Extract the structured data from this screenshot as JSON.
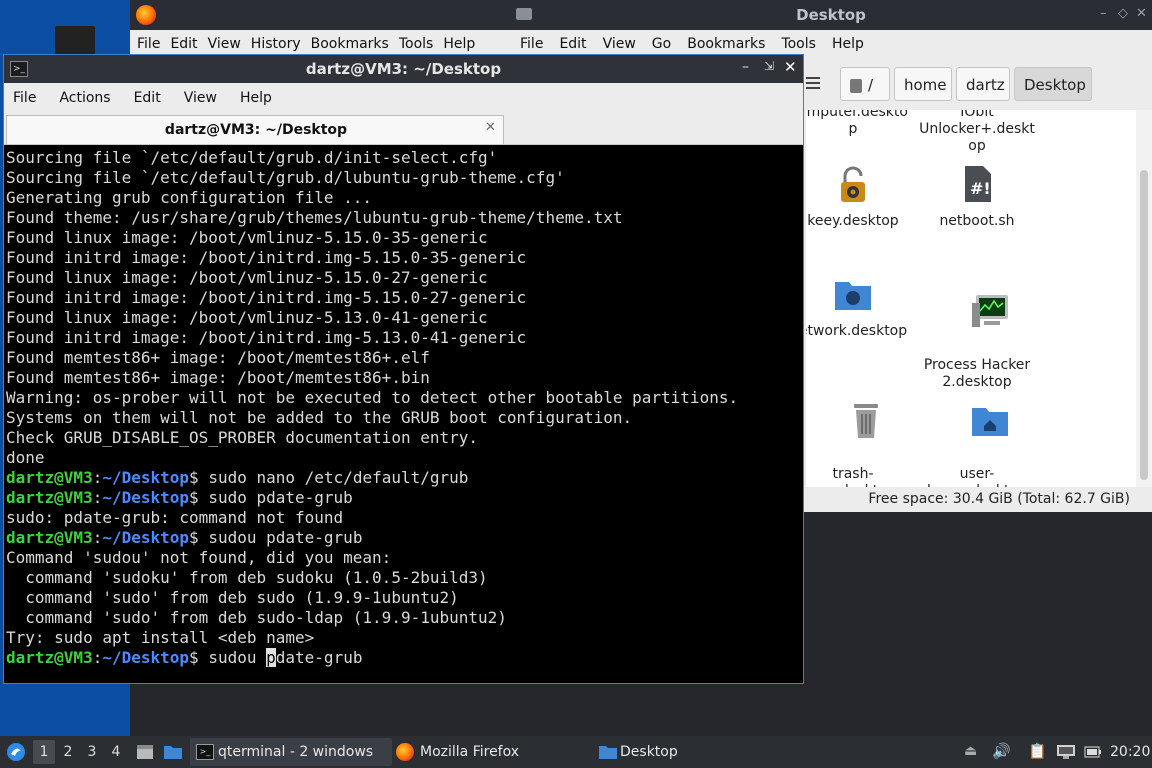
{
  "firefox": {
    "menu": [
      "File",
      "Edit",
      "View",
      "History",
      "Bookmarks",
      "Tools",
      "Help"
    ]
  },
  "file_manager": {
    "title": "Desktop",
    "menu": [
      "File",
      "Edit",
      "View",
      "Go",
      "Bookmarks",
      "Tools",
      "Help"
    ],
    "breadcrumbs": [
      "/",
      "home",
      "dartz",
      "Desktop"
    ],
    "items": [
      {
        "label": "omputer.deskto\np",
        "icon": "computer-icon"
      },
      {
        "label": "IObit\nUnlocker+.deskt\nop",
        "icon": "unlocker-icon"
      },
      {
        "label": "keey.desktop",
        "icon": "padlock-gear-icon"
      },
      {
        "label": "netboot.sh",
        "icon": "script-icon"
      },
      {
        "label": "etwork.desktop",
        "icon": "network-folder-icon"
      },
      {
        "label": "Process Hacker\n2.desktop",
        "icon": "monitor-icon"
      },
      {
        "label": "trash-\ncan.desktop",
        "icon": "trash-icon"
      },
      {
        "label": "user-\nhome.desktop",
        "icon": "home-folder-icon"
      }
    ],
    "status": "Free space: 30.4 GiB (Total: 62.7 GiB)"
  },
  "terminal": {
    "title": "dartz@VM3: ~/Desktop",
    "menu": [
      "File",
      "Actions",
      "Edit",
      "View",
      "Help"
    ],
    "tab_label": "dartz@VM3: ~/Desktop",
    "prompt_user": "dartz@VM3",
    "prompt_path": "~/Desktop",
    "lines": [
      {
        "t": "Sourcing file `/etc/default/grub.d/init-select.cfg'"
      },
      {
        "t": "Sourcing file `/etc/default/grub.d/lubuntu-grub-theme.cfg'"
      },
      {
        "t": "Generating grub configuration file ..."
      },
      {
        "t": "Found theme: /usr/share/grub/themes/lubuntu-grub-theme/theme.txt"
      },
      {
        "t": "Found linux image: /boot/vmlinuz-5.15.0-35-generic"
      },
      {
        "t": "Found initrd image: /boot/initrd.img-5.15.0-35-generic"
      },
      {
        "t": "Found linux image: /boot/vmlinuz-5.15.0-27-generic"
      },
      {
        "t": "Found initrd image: /boot/initrd.img-5.15.0-27-generic"
      },
      {
        "t": "Found linux image: /boot/vmlinuz-5.13.0-41-generic"
      },
      {
        "t": "Found initrd image: /boot/initrd.img-5.13.0-41-generic"
      },
      {
        "t": "Found memtest86+ image: /boot/memtest86+.elf"
      },
      {
        "t": "Found memtest86+ image: /boot/memtest86+.bin"
      },
      {
        "t": "Warning: os-prober will not be executed to detect other bootable partitions."
      },
      {
        "t": "Systems on them will not be added to the GRUB boot configuration."
      },
      {
        "t": "Check GRUB_DISABLE_OS_PROBER documentation entry."
      },
      {
        "t": "done"
      },
      {
        "p": true,
        "t": " sudo nano /etc/default/grub"
      },
      {
        "p": true,
        "t": " sudo pdate-grub"
      },
      {
        "t": "sudo: pdate-grub: command not found"
      },
      {
        "p": true,
        "t": " sudou pdate-grub"
      },
      {
        "t": "Command 'sudou' not found, did you mean:"
      },
      {
        "t": "  command 'sudoku' from deb sudoku (1.0.5-2build3)"
      },
      {
        "t": "  command 'sudo' from deb sudo (1.9.9-1ubuntu2)"
      },
      {
        "t": "  command 'sudo' from deb sudo-ldap (1.9.9-1ubuntu2)"
      },
      {
        "t": "Try: sudo apt install <deb name>"
      }
    ],
    "current_input_before": " sudou ",
    "current_input_cursor": "p",
    "current_input_after": "date-grub"
  },
  "taskbar": {
    "workspaces": [
      "1",
      "2",
      "3",
      "4"
    ],
    "tasks": [
      {
        "label": "qterminal - 2 windows",
        "icon": "terminal-icon"
      },
      {
        "label": "Mozilla Firefox",
        "icon": "firefox-icon"
      },
      {
        "label": "Desktop",
        "icon": "folder-icon"
      }
    ],
    "clock": "20:20"
  }
}
